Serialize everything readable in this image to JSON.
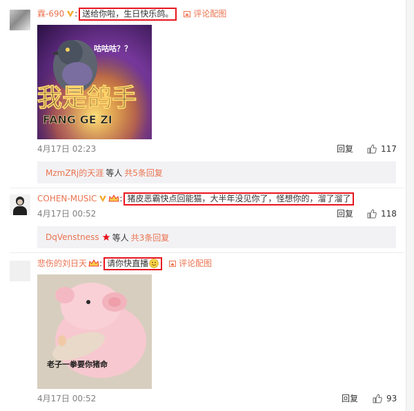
{
  "comments": [
    {
      "username": "霖-690",
      "colon": ":",
      "text": "送给你啦，生日快乐鸽。",
      "pic_link": "评论配图",
      "image": {
        "caption_small": "咕咕咕？？",
        "caption_big": "我是鸽手",
        "caption_en": "FANG GE ZI"
      },
      "time": "4月17日 02:23",
      "reply_label": "回复",
      "like_count": "117",
      "sub": {
        "name": "MzmZRj的天涯",
        "rest": "等人",
        "count_label": "共5条回复"
      }
    },
    {
      "username": "COHEN-MUSIC",
      "colon": ":",
      "text": "猪皮恶霸快点回能猫，大半年没见你了，怪想你的，溜了溜了",
      "time": "4月17日 00:52",
      "reply_label": "回复",
      "like_count": "118",
      "sub": {
        "name": "DqVenstness",
        "rest": "等人",
        "count_label": "共3条回复"
      }
    },
    {
      "username": "悲伤的刘日天",
      "colon": ":",
      "text": "请你快直播",
      "pic_link": "评论配图",
      "image": {
        "caption": "老子一拳要你猪命"
      },
      "time": "4月17日 00:52",
      "reply_label": "回复",
      "like_count": "93"
    }
  ],
  "colors": {
    "username": "#eb7350",
    "highlight_box": "#e8141e",
    "meta_text": "#808080",
    "sub_bar_bg": "#f2f2f5"
  }
}
